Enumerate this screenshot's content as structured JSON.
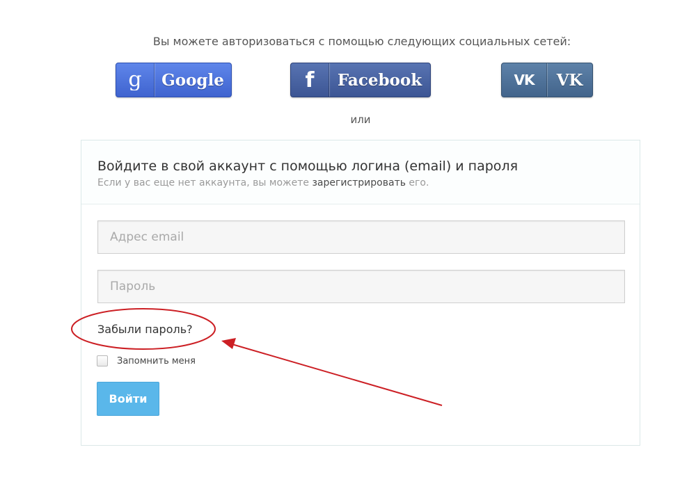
{
  "social": {
    "caption": "Вы можете авторизоваться с помощью следующих социальных сетей:",
    "buttons": [
      {
        "label": "Google",
        "icon": "google-g-icon",
        "color": "#4b6fd9"
      },
      {
        "label": "Facebook",
        "icon": "facebook-f-icon",
        "color": "#4862a3"
      },
      {
        "label": "VK",
        "icon": "vk-logo-icon",
        "color": "#50729a"
      }
    ],
    "separator": "или"
  },
  "login": {
    "title": "Войдите в свой аккаунт с помощью логина (email) и пароля",
    "subtitle_before": "Если у вас еще нет аккаунта, вы можете ",
    "register_link": "зарегистрировать",
    "subtitle_after": " его.",
    "email_placeholder": "Адрес email",
    "password_placeholder": "Пароль",
    "forgot_link": "Забыли пароль?",
    "remember_label": "Запомнить меня",
    "submit_label": "Войти",
    "submit_color": "#5ab7ea"
  },
  "annotation": {
    "color": "#cc1f24"
  }
}
